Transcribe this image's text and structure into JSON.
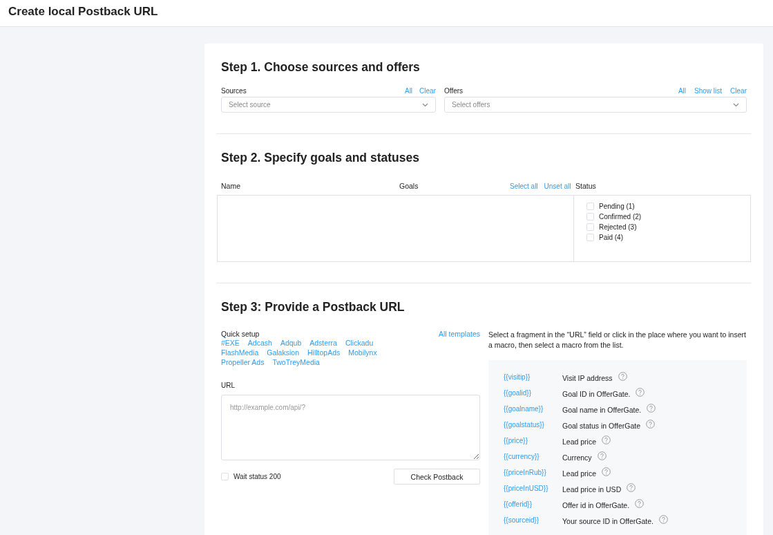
{
  "header": {
    "title": "Create local Postback URL"
  },
  "step1": {
    "title": "Step 1. Choose sources and offers",
    "sources": {
      "label": "Sources",
      "links": [
        "All",
        "Clear"
      ],
      "placeholder": "Select source"
    },
    "offers": {
      "label": "Offers",
      "links": [
        "All",
        "Show list",
        "Clear"
      ],
      "placeholder": "Select offers"
    }
  },
  "step2": {
    "title": "Step 2. Specify goals and statuses",
    "columns": {
      "name": "Name",
      "goals": "Goals",
      "status": "Status"
    },
    "goal_links": [
      "Select all",
      "Unset all"
    ],
    "statuses": [
      {
        "label": "Pending (1)",
        "checked": false
      },
      {
        "label": "Confirmed (2)",
        "checked": false
      },
      {
        "label": "Rejected (3)",
        "checked": false
      },
      {
        "label": "Paid (4)",
        "checked": false
      }
    ]
  },
  "step3": {
    "title": "Step 3: Provide a Postback URL",
    "quick_setup": {
      "label": "Quick setup",
      "all_templates": "All templates",
      "templates": [
        "#EXE",
        "Adcash",
        "Adqub",
        "Adsterra",
        "Clickadu",
        "FlashMedia",
        "Galaksion",
        "HilltopAds",
        "Mobilynx",
        "Propeller Ads",
        "TwoTreyMedia"
      ]
    },
    "url": {
      "label": "URL",
      "placeholder": "http://example.com/api/?"
    },
    "wait_status": {
      "label": "Wait status 200",
      "checked": false
    },
    "check_button": "Check Postback",
    "hint": "Select a fragment in the “URL” field or click in the place where you want to insert a macro, then select a macro from the list.",
    "macros": [
      {
        "macro": "{{visitip}}",
        "description": "Visit IP address"
      },
      {
        "macro": "{{goalid}}",
        "description": "Goal ID in OfferGate."
      },
      {
        "macro": "{{goalname}}",
        "description": "Goal name in OfferGate."
      },
      {
        "macro": "{{goalstatus}}",
        "description": "Goal status in OfferGate"
      },
      {
        "macro": "{{price}}",
        "description": "Lead price"
      },
      {
        "macro": "{{currency}}",
        "description": "Currency"
      },
      {
        "macro": "{{priceInRub}}",
        "description": "Lead price"
      },
      {
        "macro": "{{priceInUSD}}",
        "description": "Lead price in USD"
      },
      {
        "macro": "{{offerid}}",
        "description": "Offer id in OfferGate."
      },
      {
        "macro": "{{sourceid}}",
        "description": "Your source ID in OfferGate."
      }
    ]
  }
}
